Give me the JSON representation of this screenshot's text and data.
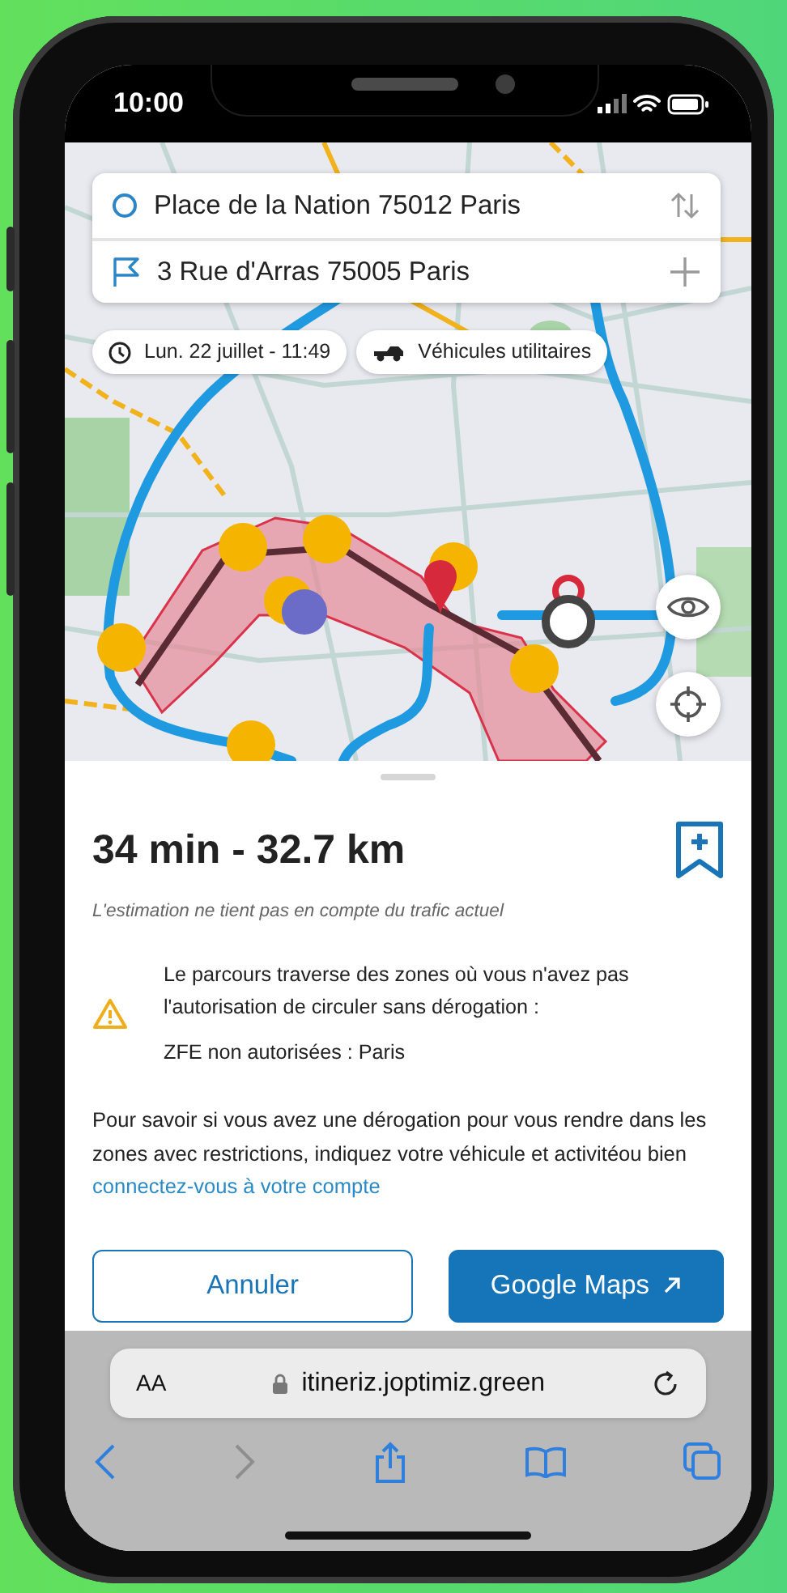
{
  "status_bar": {
    "time": "10:00"
  },
  "route_form": {
    "origin": "Place de la Nation 75012 Paris",
    "destination": "3 Rue d'Arras 75005 Paris"
  },
  "chips": [
    {
      "kind": "date",
      "label": "Lun. 22 juillet - 11:49"
    },
    {
      "kind": "vehicle",
      "label": "Véhicules utilitaires"
    }
  ],
  "route_summary": {
    "title": "34 min - 32.7 km",
    "note": "L'estimation ne tient pas en compte du trafic actuel"
  },
  "warning": {
    "message": "Le parcours traverse des zones où vous n'avez pas l'autorisation de circuler sans dérogation :",
    "detail": "ZFE non autorisées : Paris"
  },
  "info": {
    "text": "Pour savoir si vous avez une dérogation pour vous rendre dans les zones avec restrictions, indiquez votre véhicule et activitéou bien",
    "link": "connectez-vous à votre compte"
  },
  "buttons": [
    {
      "kind": "secondary",
      "label": "Annuler",
      "external": false
    },
    {
      "kind": "primary",
      "label": "Google Maps",
      "external": true
    }
  ],
  "browser": {
    "text_size": "AA",
    "url": "itineriz.joptimiz.green",
    "back_disabled": false,
    "forward_disabled": true
  }
}
